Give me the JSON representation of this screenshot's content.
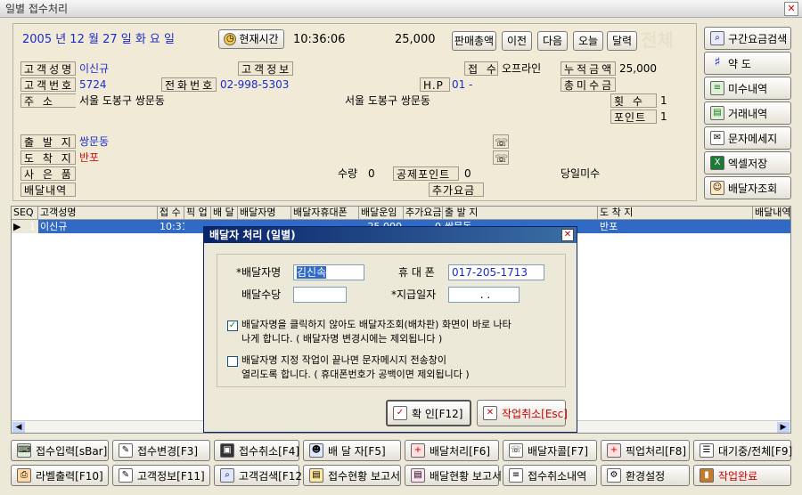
{
  "window": {
    "title": "일별 접수처리",
    "close_glyph": "✕"
  },
  "header": {
    "date": "2005 년   12 월  27 일  화 요 일",
    "now_button": "현재시간",
    "time": "10:36:06",
    "amount": "25,000",
    "buttons": [
      "판매총액",
      "이전",
      "다음",
      "오늘",
      "달력"
    ],
    "watermark": "전체"
  },
  "form": {
    "customer_name_label": "고객성명",
    "customer_name": "이신규",
    "customer_info_label": "고객정보",
    "receipt_label": "접 수",
    "receipt_value": "오프라인",
    "accum_label": "누적금액",
    "accum_value": "25,000",
    "customer_no_label": "고객번호",
    "customer_no": "5724",
    "phone_label": "전화번호",
    "phone": "02-998-5303",
    "hp_label": "H.P",
    "hp": "01 -",
    "unpaid_label": "총미수금",
    "address_label": "주   소",
    "address": "서울 도봉구 쌍문동",
    "address2": "서울 도봉구 쌍문동",
    "count_label": "횟 수",
    "count_value": "1",
    "point_label": "포인트",
    "point_value": "1",
    "origin_label": "출 발 지",
    "origin": "쌍문동",
    "dest_label": "도 착 지",
    "dest": "반포",
    "item_label": "사 은 품",
    "delivery_label": "배달내역",
    "qty_label": "수량",
    "qty": "0",
    "deduct_label": "공제포인트",
    "deduct": "0",
    "today_unpaid_label": "당일미수",
    "extra_label": "추가요금",
    "tel_icon_1": "☏",
    "tel_icon_2": "☏"
  },
  "side_buttons": [
    {
      "label": "구간요금검색",
      "icon": "search-icon"
    },
    {
      "label": "약 도",
      "icon": "map-icon"
    },
    {
      "label": "미수내역",
      "icon": "receipt-icon"
    },
    {
      "label": "거래내역",
      "icon": "ledger-icon"
    },
    {
      "label": "문자메세지",
      "icon": "message-icon"
    },
    {
      "label": "엑셀저장",
      "icon": "excel-icon"
    },
    {
      "label": "배달자조회",
      "icon": "people-icon"
    }
  ],
  "grid": {
    "headers": [
      "SEQ",
      "고객성명",
      "접 수",
      "픽 업",
      "배 달",
      "배달자명",
      "배달자휴대폰",
      "배달운임",
      "추가요금",
      "출 발 지",
      "도 착 지",
      "배달내역"
    ],
    "row": [
      "1",
      "이신규",
      "10:31",
      "",
      "",
      "",
      "",
      "25,000",
      "0",
      "쌍문동",
      "반포",
      ""
    ]
  },
  "dialog": {
    "title": "배달자 처리 (일별)",
    "name_label": "*배달자명",
    "name_value": "김신속",
    "mobile_label": "휴 대 폰",
    "mobile_value": "017-205-1713",
    "allowance_label": "배달수당",
    "allowance_value": "",
    "paydate_label": "*지급일자",
    "paydate_value": ". .",
    "option1_line1": "배달자명을 클릭하지 않아도 배달자조회(배차판) 화면이 바로 나타",
    "option1_line2": "나게 합니다. ( 배달자명 변경시에는 제외됩니다 )",
    "option2_line1": "배달자명 지정 작업이 끝나면 문자메시지 전송창이",
    "option2_line2": "열리도록 합니다. ( 휴대폰번호가 공백이면 제외됩니다 )",
    "ok_label": "확 인[F12]",
    "cancel_label": "작업취소[Esc]"
  },
  "bottom_row1": [
    "접수입력[sBar]",
    "접수변경[F3]",
    "접수취소[F4]",
    "배 달 자[F5]",
    "배달처리[F6]",
    "배달자콜[F7]",
    "픽업처리[F8]",
    "대기중/전체[F9]"
  ],
  "bottom_row2": [
    "라벨출력[F10]",
    "고객정보[F11]",
    "고객검색[F12]",
    "접수현황 보고서",
    "배달현황 보고서",
    "접수취소내역",
    "환경설정",
    "작업완료"
  ],
  "colors": {
    "accent_blue": "#1a2bd0",
    "accent_red": "#d01010",
    "selection": "#316ac5"
  }
}
